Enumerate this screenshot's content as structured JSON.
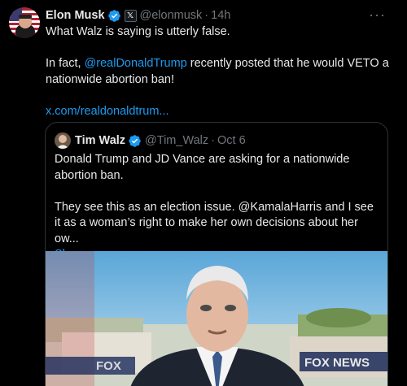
{
  "tweet": {
    "author_name": "Elon Musk",
    "author_handle": "@elonmusk",
    "separator": "·",
    "time": "14h",
    "more_label": "···",
    "affiliate_badge": "𝕏",
    "text_line1": "What Walz is saying is utterly false.",
    "text_line2_prefix": "In fact, ",
    "mention": "@realDonaldTrump",
    "text_line2_suffix": " recently posted that he would VETO a nationwide abortion ban!",
    "link": "x.com/realdonaldtrum..."
  },
  "quote": {
    "author_name": "Tim Walz",
    "author_handle": "@Tim_Walz",
    "separator": "·",
    "date": "Oct 6",
    "para1": "Donald Trump and JD Vance are asking for a nationwide abortion ban.",
    "para2": "They see this as an election issue. @KamalaHarris and I see it as a woman’s right to make her own decisions about her ow...",
    "show_more": "Show more",
    "image_watermark_left": "FOX",
    "image_watermark_right": "FOX NEWS"
  },
  "colors": {
    "background": "#000000",
    "text": "#e7e9ea",
    "muted": "#71767b",
    "link": "#1d9bf0",
    "border": "#2f3336",
    "verified": "#1d9bf0"
  },
  "icons": [
    "elon-avatar",
    "verified-icon",
    "x-affiliate-icon",
    "more-icon",
    "walz-avatar"
  ]
}
